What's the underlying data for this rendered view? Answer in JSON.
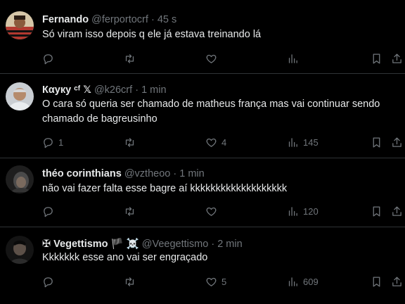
{
  "tweets": [
    {
      "name": "Fernando",
      "handle": "@ferportocrf",
      "time": "45 s",
      "text": "Só viram isso depois q ele já estava treinando lá",
      "reply_count": "",
      "retweet_count": "",
      "like_count": "",
      "view_count": "",
      "avatar_color": "#b2382f"
    },
    {
      "name": "Кαуку",
      "name_suffix": "ᶜᶠ 𝕏",
      "handle": "@k26crf",
      "time": "1 min",
      "text": "O cara só queria ser chamado de matheus frança mas vai continuar sendo chamado de bagreusinho",
      "reply_count": "1",
      "retweet_count": "",
      "like_count": "4",
      "view_count": "145",
      "avatar_color": "#9aa3ab"
    },
    {
      "name": "théo corinthians",
      "handle": "@vztheoo",
      "time": "1 min",
      "text": "não vai fazer falta esse bagre aí kkkkkkkkkkkkkkkkkkk",
      "reply_count": "",
      "retweet_count": "",
      "like_count": "",
      "view_count": "120",
      "avatar_color": "#2a2a2a"
    },
    {
      "name": "✠ Vegettismo",
      "name_suffix": "🏴 ☠️",
      "handle": "@Veegettismo",
      "time": "2 min",
      "text": "Kkkkkkk esse ano vai ser engraçado",
      "reply_count": "",
      "retweet_count": "",
      "like_count": "5",
      "view_count": "609",
      "avatar_color": "#1c1c1c"
    }
  ],
  "separator": "·",
  "colors": {
    "background": "#000000",
    "text": "#e7e9ea",
    "muted": "#71767b",
    "border": "#2f3336"
  }
}
